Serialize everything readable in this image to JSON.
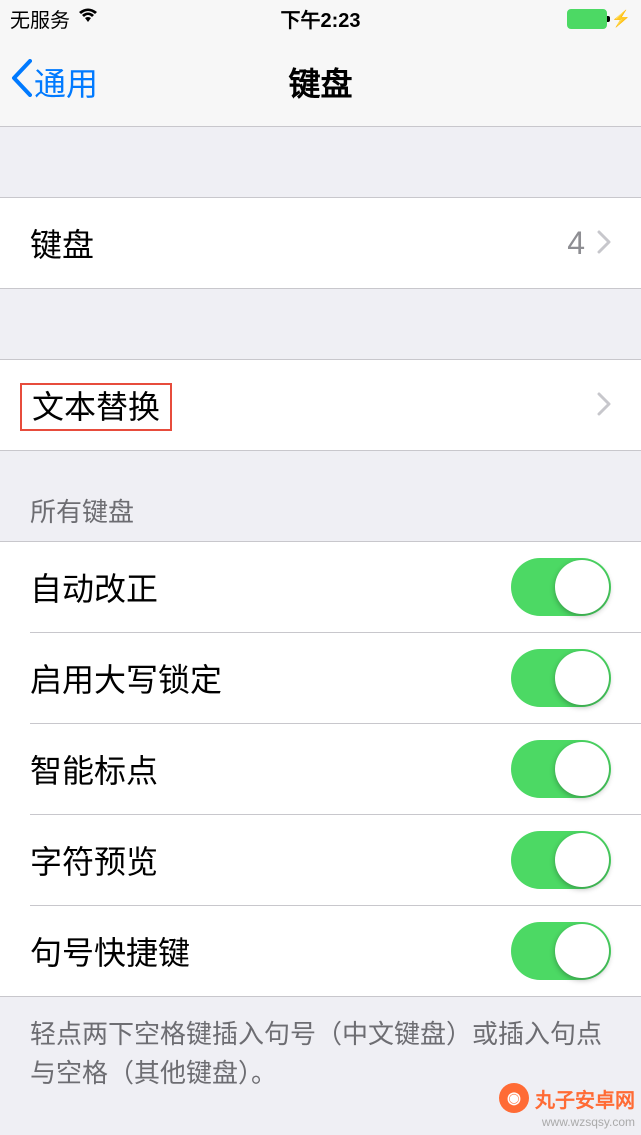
{
  "status": {
    "carrier": "无服务",
    "time": "下午2:23"
  },
  "nav": {
    "back_label": "通用",
    "title": "键盘"
  },
  "cells": {
    "keyboards": {
      "label": "键盘",
      "count": "4"
    },
    "text_replace": {
      "label": "文本替换"
    }
  },
  "section": {
    "header": "所有键盘",
    "footer": "轻点两下空格键插入句号（中文键盘）或插入句点与空格（其他键盘）。"
  },
  "toggles": [
    {
      "label": "自动改正",
      "on": true
    },
    {
      "label": "启用大写锁定",
      "on": true
    },
    {
      "label": "智能标点",
      "on": true
    },
    {
      "label": "字符预览",
      "on": true
    },
    {
      "label": "句号快捷键",
      "on": true
    }
  ],
  "watermark": {
    "text": "丸子安卓网",
    "url": "www.wzsqsy.com"
  }
}
